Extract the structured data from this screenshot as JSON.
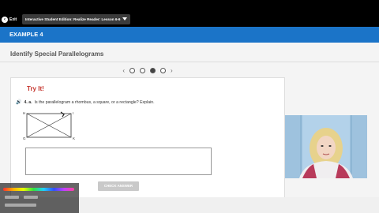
{
  "topbar": {
    "exit_label": "Exit",
    "exit_icon": "circle-arrow-left-icon",
    "lesson_title": "Interactive Student Edition: Realize Reader: Lesson 6-6",
    "dropdown_icon": "caret-down-icon"
  },
  "header": {
    "example_label": "EXAMPLE 4",
    "page_title": "Identify Special Parallelograms"
  },
  "pager": {
    "prev_icon": "chevron-left-icon",
    "next_icon": "chevron-right-icon",
    "prev_glyph": "‹",
    "next_glyph": "›",
    "dots": 4,
    "active_index": 2
  },
  "card": {
    "try_it": "Try It!",
    "question_number": "4. a.",
    "question_text": "Is the parallelogram a rhombus, a square, or a rectangle? Explain.",
    "speaker_icon": "speaker-icon",
    "speaker_glyph": "🔊",
    "figure_labels": [
      "H",
      "I",
      "G",
      "K"
    ],
    "answer_placeholder": "",
    "check_button": "CHECK ANSWER"
  },
  "colors": {
    "topbar": "#000000",
    "example_bar": "#1b74c8",
    "try_it": "#c5332b",
    "check_button": "#c9c9c9"
  }
}
